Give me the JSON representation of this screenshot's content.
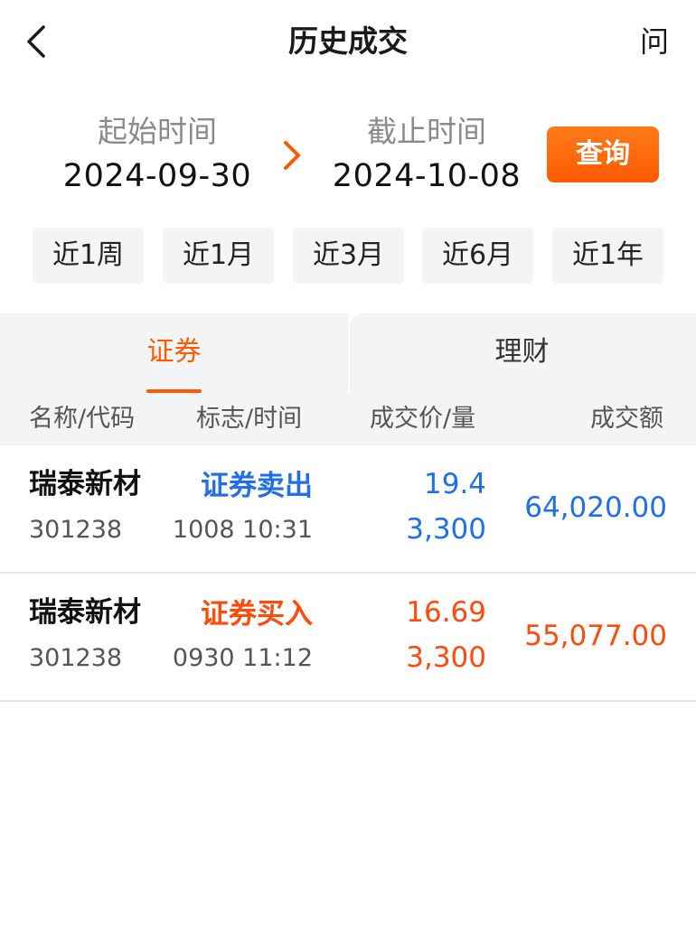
{
  "header": {
    "title": "历史成交",
    "help_label": "问"
  },
  "date_range": {
    "start_caption": "起始时间",
    "start_value": "2024-09-30",
    "end_caption": "截止时间",
    "end_value": "2024-10-08",
    "query_label": "查询"
  },
  "quick_ranges": [
    "近1周",
    "近1月",
    "近3月",
    "近6月",
    "近1年"
  ],
  "tabs": [
    {
      "label": "证券",
      "active": true
    },
    {
      "label": "理财",
      "active": false
    }
  ],
  "columns": [
    "名称/代码",
    "标志/时间",
    "成交价/量",
    "成交额"
  ],
  "trades": [
    {
      "name": "瑞泰新材",
      "code": "301238",
      "type": "证券卖出",
      "time": "1008 10:31",
      "price": "19.4",
      "quantity": "3,300",
      "amount": "64,020.00",
      "direction": "sell"
    },
    {
      "name": "瑞泰新材",
      "code": "301238",
      "type": "证券买入",
      "time": "0930 11:12",
      "price": "16.69",
      "quantity": "3,300",
      "amount": "55,077.00",
      "direction": "buy"
    }
  ],
  "colors": {
    "accent": "#ff5a00",
    "sell": "#1f6fe8",
    "buy": "#ff4a0a",
    "chip_bg": "#f3f4f6"
  },
  "icons": {
    "back": "chevron-left-icon",
    "range_arrow": "chevron-right-icon"
  }
}
